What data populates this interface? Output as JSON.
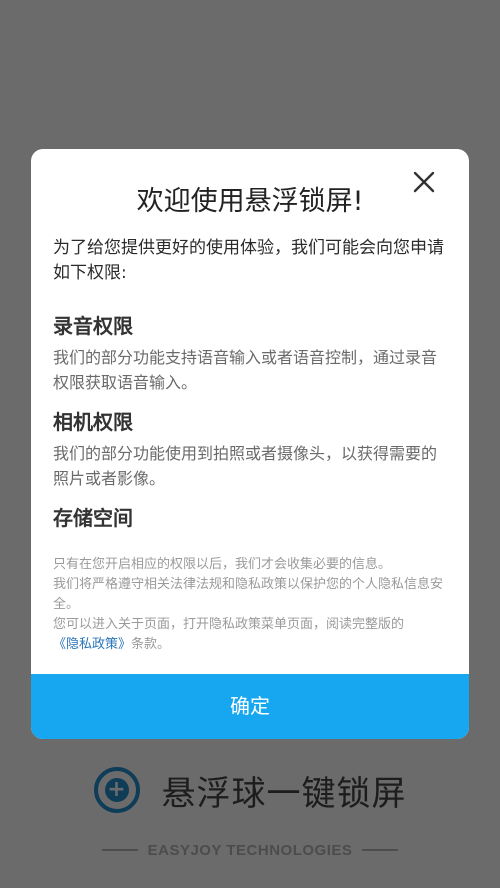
{
  "background_app": {
    "app_name": "悬浮球一键锁屏",
    "logo_glyph": "+",
    "company": "EASYJOY TECHNOLOGIES",
    "icon": "plus-circle-icon"
  },
  "dialog": {
    "title": "欢迎使用悬浮锁屏!",
    "close_icon": "close-icon",
    "intro": "为了给您提供更好的使用体验，我们可能会向您申请如下权限:",
    "permissions": [
      {
        "title": "录音权限",
        "desc": "我们的部分功能支持语音输入或者语音控制，通过录音权限获取语音输入。"
      },
      {
        "title": "相机权限",
        "desc": "我们的部分功能使用到拍照或者摄像头，以获得需要的照片或者影像。"
      },
      {
        "title": "存储空间",
        "desc": ""
      }
    ],
    "notice": {
      "line1": "只有在您开启相应的权限以后，我们才会收集必要的信息。",
      "line2": "我们将严格遵守相关法律法规和隐私政策以保护您的个人隐私信息安全。",
      "line3": "您可以进入关于页面，打开隐私政策菜单页面，阅读完整版的",
      "link": "《隐私政策》",
      "line3_end": "条款。"
    },
    "confirm_label": "确定"
  },
  "colors": {
    "overlay": "#6b6b6b",
    "accent": "#17a6f0",
    "link": "#2a74b8",
    "dialog_bg": "#ffffff"
  }
}
